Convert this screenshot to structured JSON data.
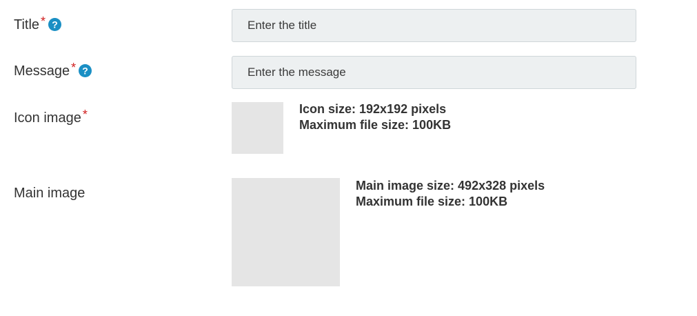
{
  "title_field": {
    "label": "Title",
    "required_mark": "*",
    "help_icon": "question-circle-icon",
    "placeholder": "Enter the title",
    "value": ""
  },
  "message_field": {
    "label": "Message",
    "required_mark": "*",
    "help_icon": "question-circle-icon",
    "placeholder": "Enter the message",
    "value": ""
  },
  "icon_image": {
    "label": "Icon image",
    "required_mark": "*",
    "hint_size": "Icon size: 192x192 pixels",
    "hint_filesize": "Maximum file size: 100KB"
  },
  "main_image": {
    "label": "Main image",
    "hint_size": "Main image size: 492x328 pixels",
    "hint_filesize": "Maximum file size: 100KB"
  },
  "colors": {
    "required": "#d01f1f",
    "help_icon": "#1a8fc4",
    "input_bg": "#edf0f1",
    "image_placeholder": "#e5e5e5"
  }
}
